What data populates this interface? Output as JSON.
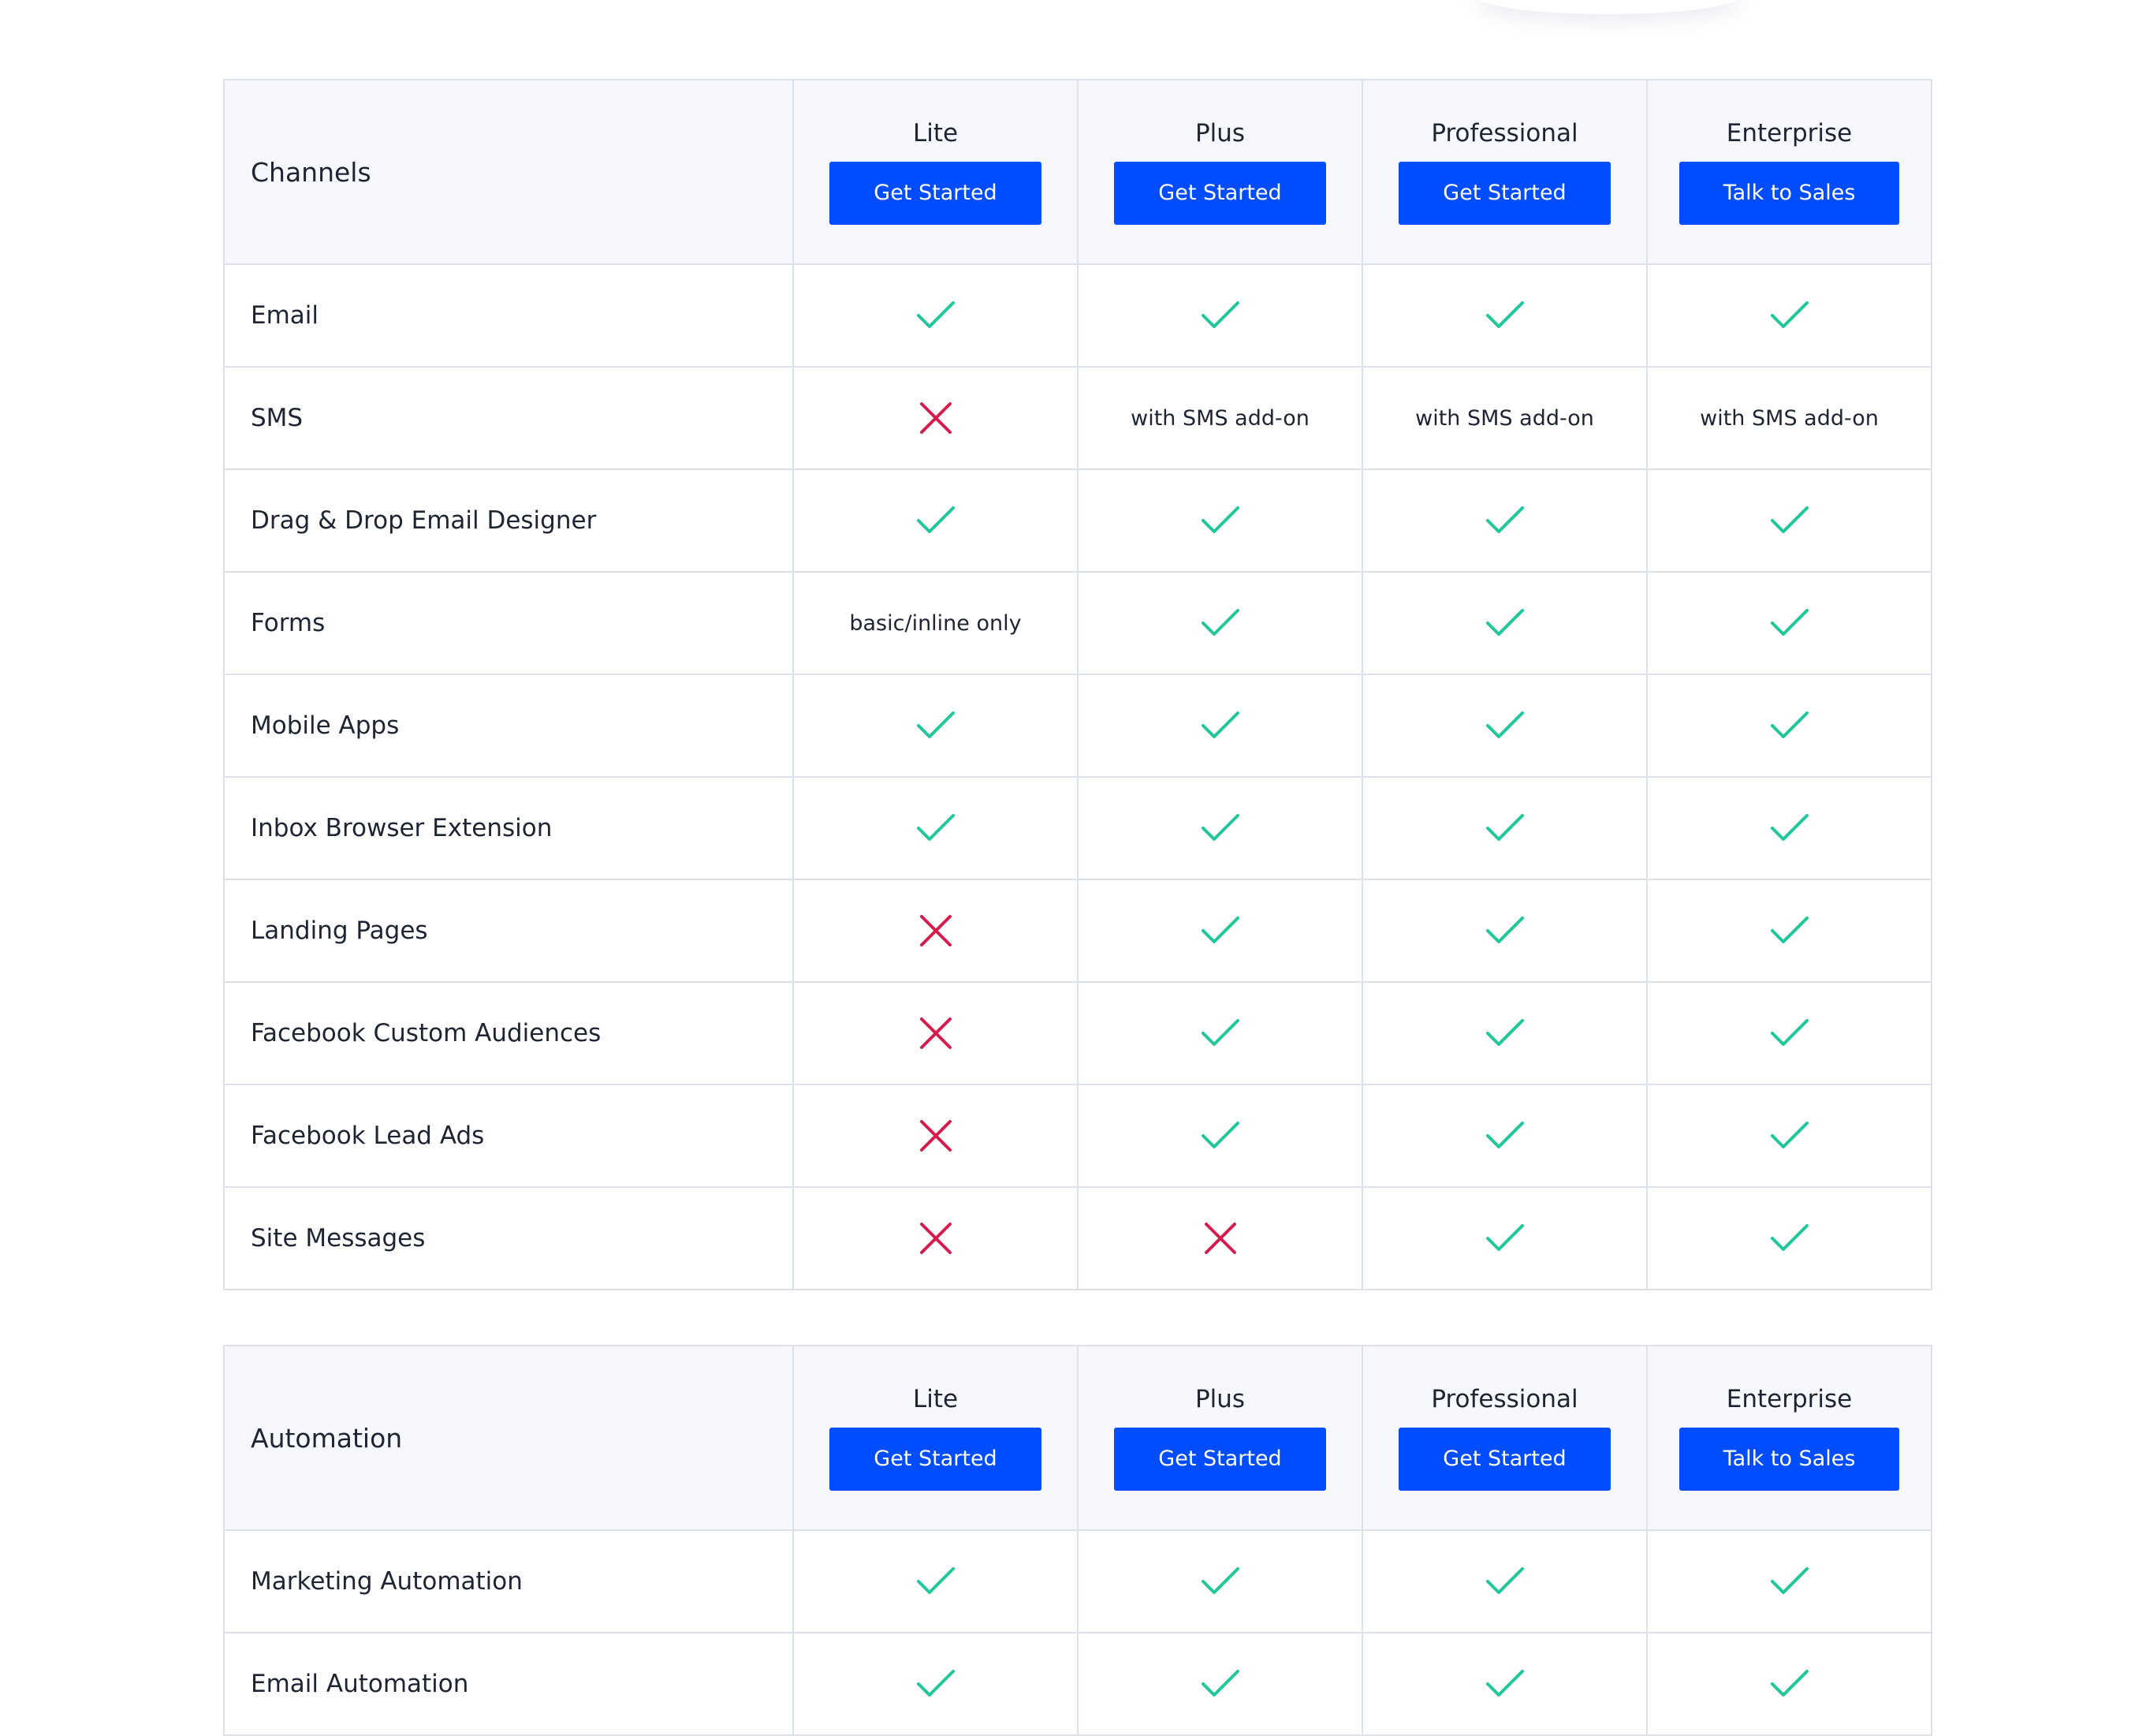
{
  "plans": [
    {
      "name": "Lite",
      "cta": "Get Started"
    },
    {
      "name": "Plus",
      "cta": "Get Started"
    },
    {
      "name": "Professional",
      "cta": "Get Started"
    },
    {
      "name": "Enterprise",
      "cta": "Talk to Sales"
    }
  ],
  "colors": {
    "check": "#1fc79a",
    "cross": "#d81b4d",
    "button": "#004cff"
  },
  "icons": {
    "check": "check-icon",
    "cross": "cross-icon"
  },
  "sections": [
    {
      "title": "Channels",
      "rows": [
        {
          "feature": "Email",
          "values": [
            "check",
            "check",
            "check",
            "check"
          ]
        },
        {
          "feature": "SMS",
          "values": [
            "cross",
            "with SMS add-on",
            "with SMS add-on",
            "with SMS add-on"
          ]
        },
        {
          "feature": "Drag & Drop Email Designer",
          "values": [
            "check",
            "check",
            "check",
            "check"
          ]
        },
        {
          "feature": "Forms",
          "values": [
            "basic/inline only",
            "check",
            "check",
            "check"
          ]
        },
        {
          "feature": "Mobile Apps",
          "values": [
            "check",
            "check",
            "check",
            "check"
          ]
        },
        {
          "feature": "Inbox Browser Extension",
          "values": [
            "check",
            "check",
            "check",
            "check"
          ]
        },
        {
          "feature": "Landing Pages",
          "values": [
            "cross",
            "check",
            "check",
            "check"
          ]
        },
        {
          "feature": "Facebook Custom Audiences",
          "values": [
            "cross",
            "check",
            "check",
            "check"
          ]
        },
        {
          "feature": "Facebook Lead Ads",
          "values": [
            "cross",
            "check",
            "check",
            "check"
          ]
        },
        {
          "feature": "Site Messages",
          "values": [
            "cross",
            "cross",
            "check",
            "check"
          ]
        }
      ]
    },
    {
      "title": "Automation",
      "rows": [
        {
          "feature": "Marketing Automation",
          "values": [
            "check",
            "check",
            "check",
            "check"
          ]
        },
        {
          "feature": "Email Automation",
          "values": [
            "check",
            "check",
            "check",
            "check"
          ]
        }
      ]
    }
  ]
}
